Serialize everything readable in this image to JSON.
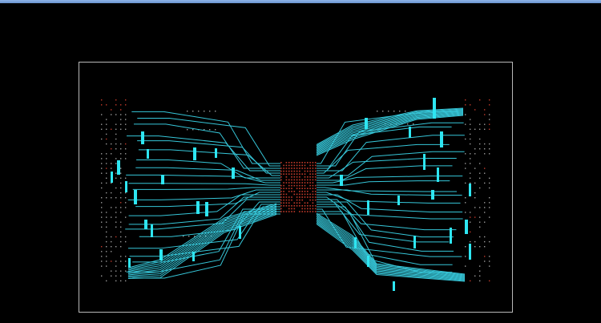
{
  "window": {
    "title": ""
  },
  "canvas": {
    "background": "#000000",
    "outline_color": "#b8b8b8",
    "trace_color": "#36c6d8",
    "pad_color": "#2ee6f2",
    "via_color": "#c23a2a",
    "dot_color": "#9a9a9a"
  },
  "layers": [
    "traces",
    "pads",
    "vias",
    "pin-dots"
  ]
}
